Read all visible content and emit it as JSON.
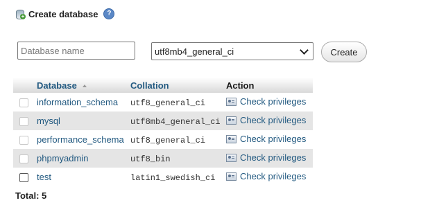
{
  "header": {
    "title": "Create database",
    "db_icon": "database-add-icon",
    "help_icon": "help-icon"
  },
  "form": {
    "db_name_placeholder": "Database name",
    "db_name_value": "",
    "collation_selected": "utf8mb4_general_ci",
    "create_label": "Create"
  },
  "table": {
    "headers": {
      "database": "Database",
      "collation": "Collation",
      "action": "Action"
    },
    "rows": [
      {
        "database": "information_schema",
        "collation": "utf8_general_ci",
        "action": "Check privileges"
      },
      {
        "database": "mysql",
        "collation": "utf8mb4_general_ci",
        "action": "Check privileges"
      },
      {
        "database": "performance_schema",
        "collation": "utf8_general_ci",
        "action": "Check privileges"
      },
      {
        "database": "phpmyadmin",
        "collation": "utf8_bin",
        "action": "Check privileges"
      },
      {
        "database": "test",
        "collation": "latin1_swedish_ci",
        "action": "Check privileges"
      }
    ]
  },
  "footer": {
    "total": "Total: 5"
  },
  "colors": {
    "link": "#235a81",
    "row_even": "#e5e5e5",
    "header_bg": "#d9d9d9"
  }
}
